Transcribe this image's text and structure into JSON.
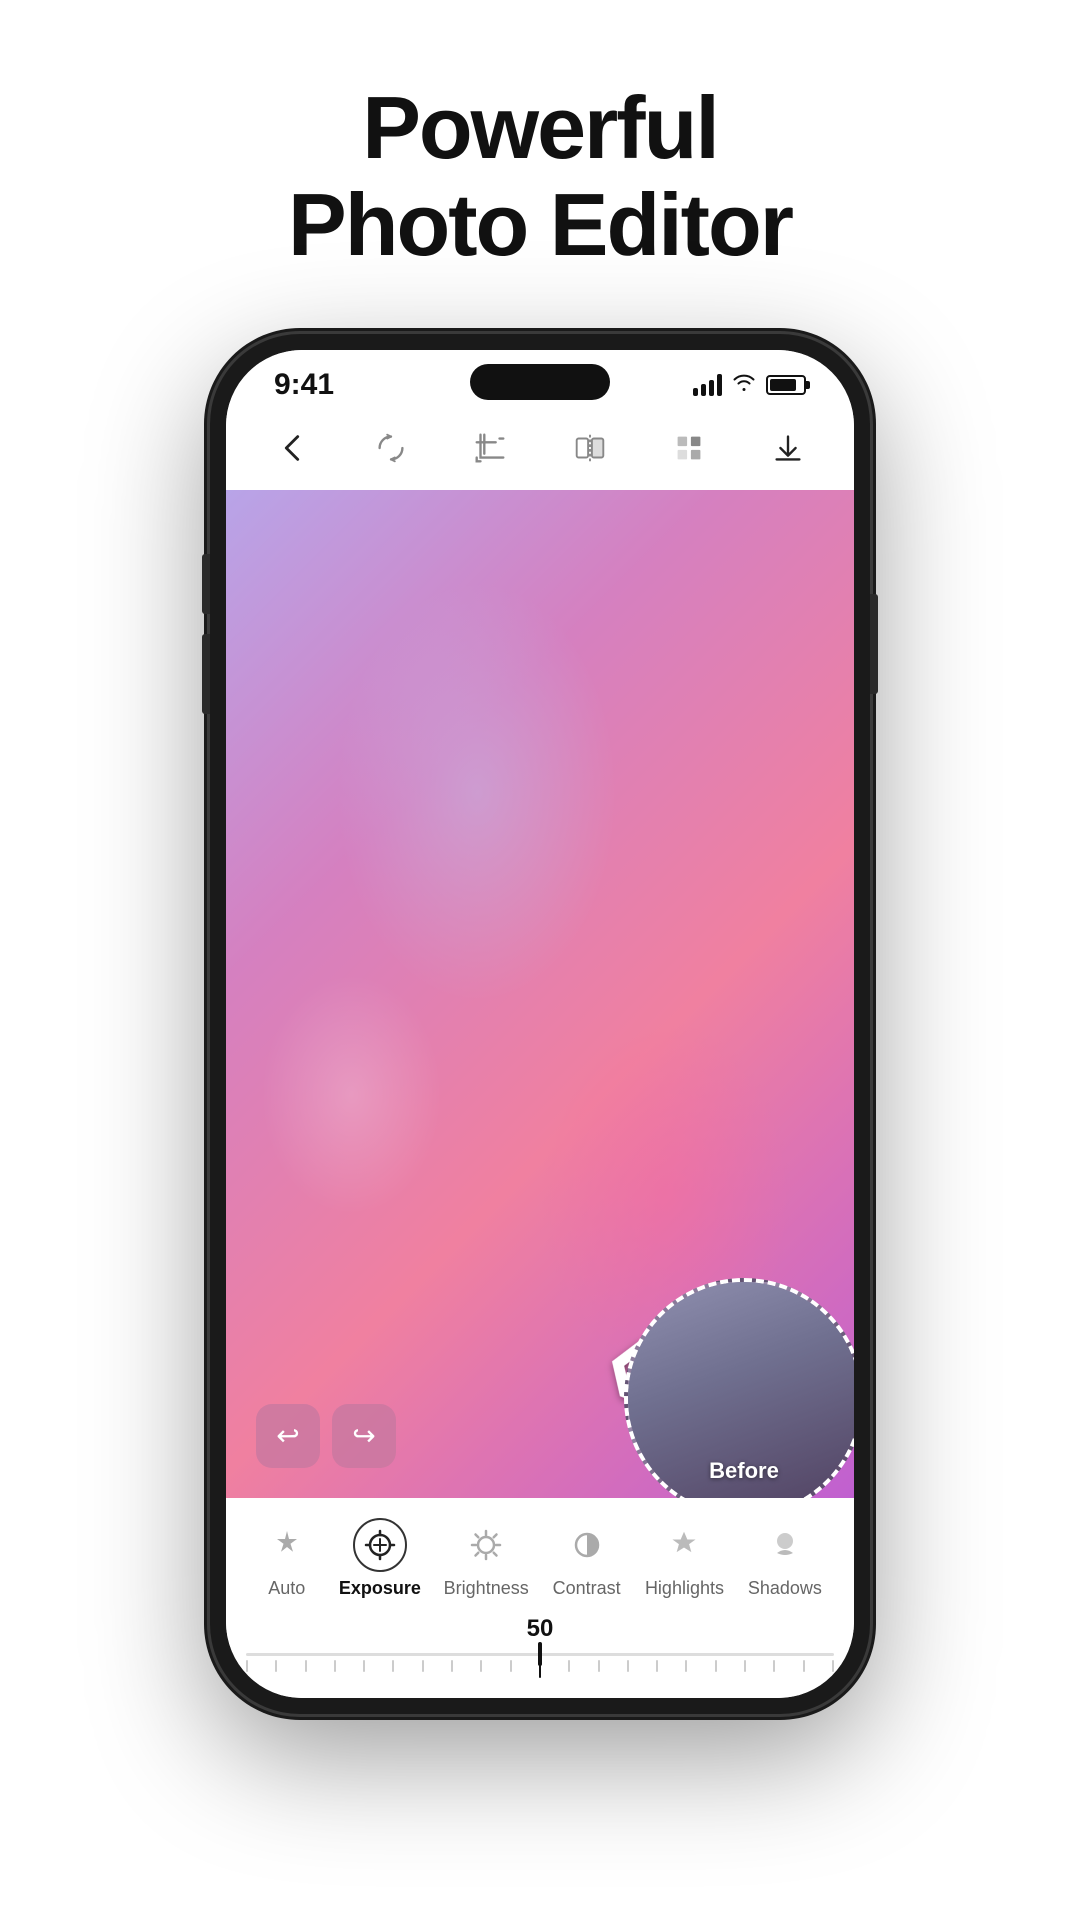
{
  "page": {
    "title_line1": "Powerful",
    "title_line2": "Photo Editor"
  },
  "status_bar": {
    "time": "9:41",
    "signal_label": "signal",
    "wifi_label": "wifi",
    "battery_label": "battery"
  },
  "toolbar": {
    "back_label": "back",
    "rotate_label": "rotate",
    "crop_label": "crop",
    "flip_label": "flip",
    "adjust_label": "adjust",
    "download_label": "download"
  },
  "tools": [
    {
      "id": "auto",
      "label": "Auto",
      "icon": "✦",
      "active": false
    },
    {
      "id": "exposure",
      "label": "Exposure",
      "icon": "⊕",
      "active": true
    },
    {
      "id": "brightness",
      "label": "Brightness",
      "icon": "☀",
      "active": false
    },
    {
      "id": "contrast",
      "label": "Contrast",
      "icon": "◑",
      "active": false
    },
    {
      "id": "highlights",
      "label": "Highlights",
      "icon": "▲",
      "active": false
    },
    {
      "id": "shadows",
      "label": "Shadows",
      "icon": "▼",
      "active": false
    }
  ],
  "slider": {
    "value": "50",
    "min": -100,
    "max": 100,
    "current": 50
  },
  "before_label": "Before"
}
